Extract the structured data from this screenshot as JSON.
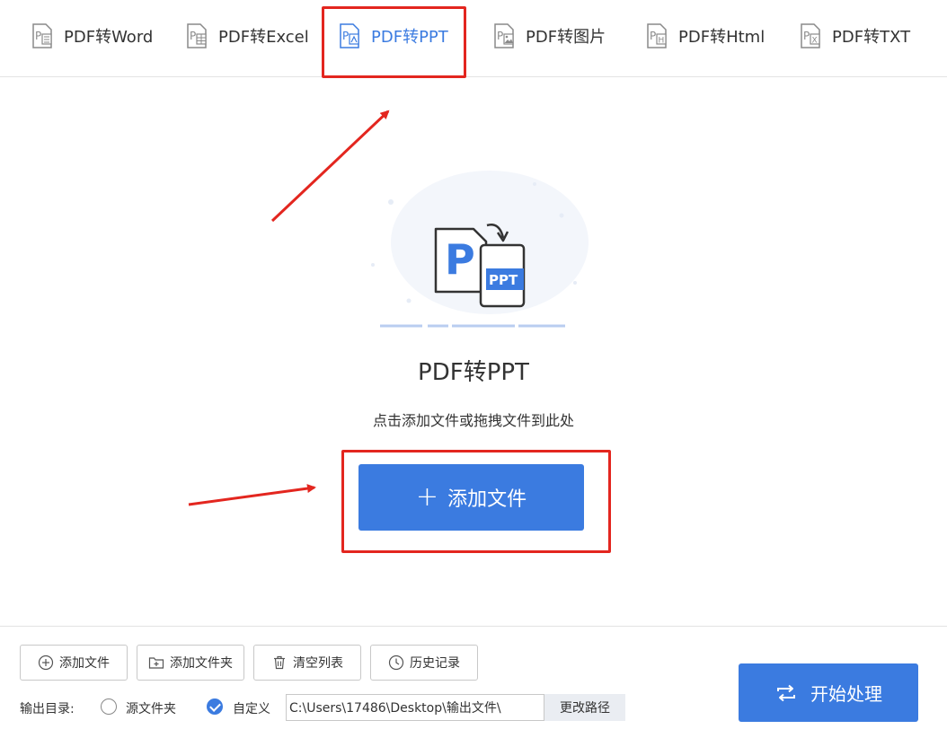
{
  "tabs": [
    {
      "label": "PDF转Word",
      "icon": "pdf-to-word-icon"
    },
    {
      "label": "PDF转Excel",
      "icon": "pdf-to-excel-icon"
    },
    {
      "label": "PDF转PPT",
      "icon": "pdf-to-ppt-icon",
      "active": true
    },
    {
      "label": "PDF转图片",
      "icon": "pdf-to-image-icon"
    },
    {
      "label": "PDF转Html",
      "icon": "pdf-to-html-icon"
    },
    {
      "label": "PDF转TXT",
      "icon": "pdf-to-txt-icon"
    }
  ],
  "hero": {
    "illustration_badge": "P",
    "illustration_target": "PPT",
    "title": "PDF转PPT",
    "subtitle": "点击添加文件或拖拽文件到此处",
    "add_button": "添加文件"
  },
  "toolbar": {
    "add_file": "添加文件",
    "add_folder": "添加文件夹",
    "clear_list": "清空列表",
    "history": "历史记录"
  },
  "output": {
    "label": "输出目录:",
    "option_source": "源文件夹",
    "option_custom": "自定义",
    "path": "C:\\Users\\17486\\Desktop\\输出文件\\",
    "change_path": "更改路径"
  },
  "start_button": "开始处理",
  "colors": {
    "accent": "#3b7be0",
    "highlight": "#e3261f",
    "text": "#333333"
  }
}
